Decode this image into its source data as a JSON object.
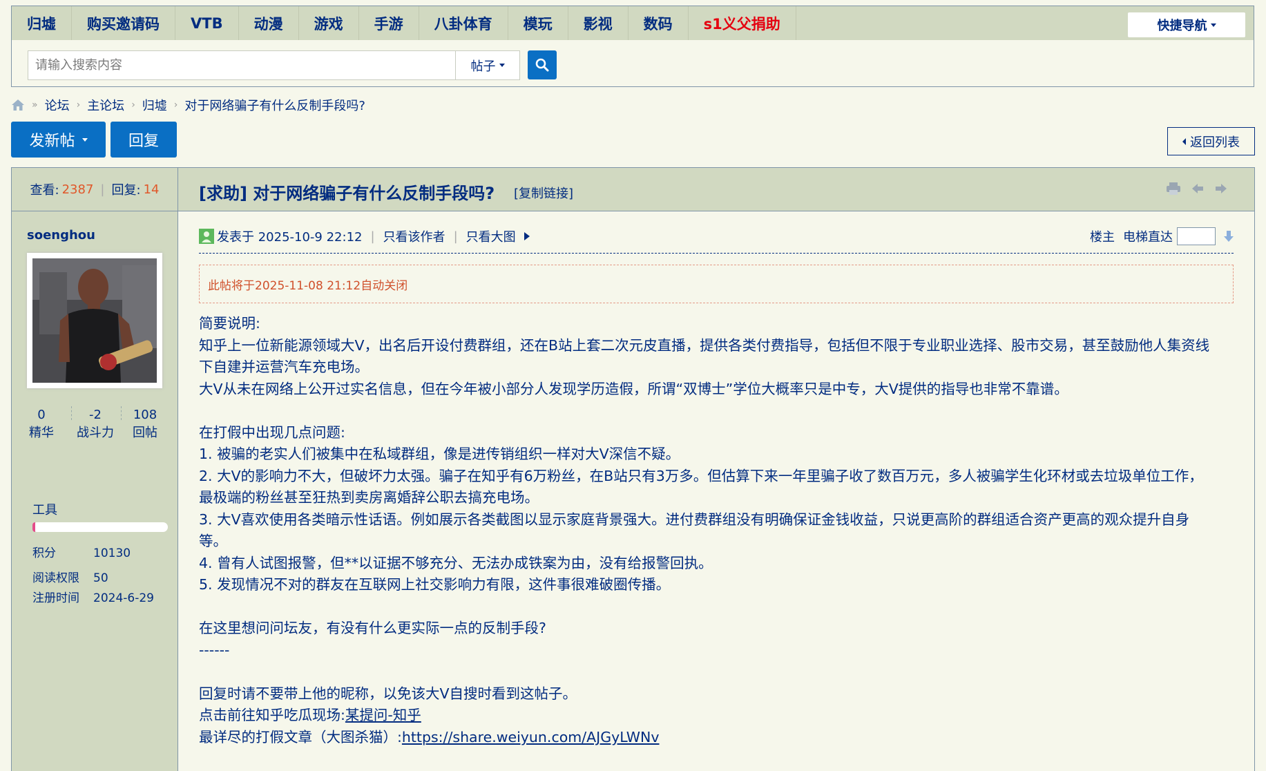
{
  "nav": {
    "items": [
      "归墟",
      "购买邀请码",
      "VTB",
      "动漫",
      "游戏",
      "手游",
      "八卦体育",
      "模玩",
      "影视",
      "数码"
    ],
    "donate": "s1义父捐助",
    "quick_nav": "快捷导航"
  },
  "search": {
    "placeholder": "请输入搜索内容",
    "type": "帖子"
  },
  "breadcrumb": [
    "论坛",
    "主论坛",
    "归墟",
    "对于网络骗子有什么反制手段吗?"
  ],
  "actions": {
    "new_post": "发新帖",
    "reply": "回复",
    "back_list": "返回列表"
  },
  "thread": {
    "views_label": "查看:",
    "views": "2387",
    "replies_label": "回复:",
    "replies": "14",
    "title": "[求助] 对于网络骗子有什么反制手段吗?",
    "copy_link": "[复制链接]"
  },
  "author": {
    "name": "soenghou",
    "stats": [
      {
        "value": "0",
        "label": "精华"
      },
      {
        "value": "-2",
        "label": "战斗力"
      },
      {
        "value": "108",
        "label": "回帖"
      }
    ],
    "tools_label": "工具",
    "progress_fraction": 0.02,
    "info": [
      {
        "key": "积分",
        "value": "10130"
      },
      {
        "key": "阅读权限",
        "value": "50"
      },
      {
        "key": "注册时间",
        "value": "2024-6-29"
      }
    ]
  },
  "post": {
    "posted": "发表于 2025-10-9 22:12",
    "only_author": "只看该作者",
    "only_big": "只看大图",
    "floor": "楼主",
    "elevator": "电梯直达",
    "close_notice": "此帖将于2025-11-08 21:12自动关闭",
    "lines": [
      "简要说明:",
      "知乎上一位新能源领域大V，出名后开设付费群组，还在B站上套二次元皮直播，提供各类付费指导，包括但不限于专业职业选择、股市交易，甚至鼓励他人集资线",
      "下自建并运营汽车充电场。",
      "大V从未在网络上公开过实名信息，但在今年被小部分人发现学历造假，所谓“双博士”学位大概率只是中专，大V提供的指导也非常不靠谱。",
      "",
      "在打假中出现几点问题:",
      "1. 被骗的老实人们被集中在私域群组，像是进传销组织一样对大V深信不疑。",
      "2. 大V的影响力不大，但破坏力太强。骗子在知乎有6万粉丝，在B站只有3万多。但估算下来一年里骗子收了数百万元，多人被骗学生化环材或去垃圾单位工作，",
      "最极端的粉丝甚至狂热到卖房离婚辞公职去搞充电场。",
      "3. 大V喜欢使用各类暗示性话语。例如展示各类截图以显示家庭背景强大。进付费群组没有明确保证金钱收益，只说更高阶的群组适合资产更高的观众提升自身",
      "等。",
      "4. 曾有人试图报警，但**以证据不够充分、无法办成铁案为由，没有给报警回执。",
      "5. 发现情况不对的群友在互联网上社交影响力有限，这件事很难破圈传播。",
      "",
      "在这里想问问坛友，有没有什么更实际一点的反制手段?",
      "------",
      "",
      "回复时请不要带上他的昵称，以免该大V自搜时看到这帖子。"
    ],
    "link1_prefix": "点击前往知乎吃瓜现场:",
    "link1_text": "某提问-知乎",
    "link2_prefix": "最详尽的打假文章（大图杀猫）:",
    "link2_text": "https://share.weiyun.com/AJGyLWNv"
  }
}
